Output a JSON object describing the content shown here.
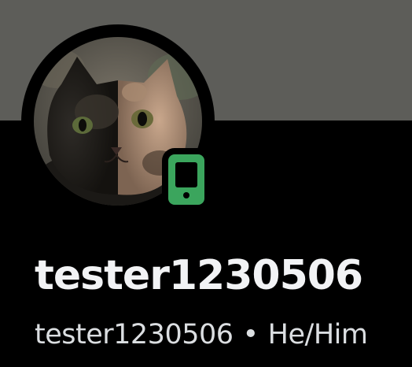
{
  "profile": {
    "display_name": "tester1230506",
    "username": "tester1230506",
    "separator": "•",
    "pronouns": "He/Him",
    "status": "online-mobile",
    "status_icon": "mobile-phone-icon"
  },
  "colors": {
    "banner": "#5d5d59",
    "background": "#000000",
    "status_online": "#3ba55d",
    "name_text": "#f2f3f5",
    "sub_text": "#dbdee1"
  }
}
